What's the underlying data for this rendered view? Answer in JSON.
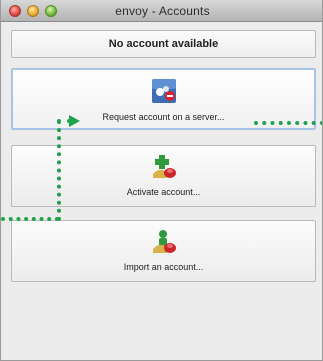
{
  "window": {
    "title": "envoy - Accounts"
  },
  "status": {
    "text": "No account available"
  },
  "actions": [
    {
      "label": "Request account on a server...",
      "icon": "server-account-icon"
    },
    {
      "label": "Activate account...",
      "icon": "activate-account-icon"
    },
    {
      "label": "Import an account...",
      "icon": "import-account-icon"
    }
  ],
  "colors": {
    "annotation": "#1fa24a",
    "selection_border": "#a7c4e6"
  }
}
